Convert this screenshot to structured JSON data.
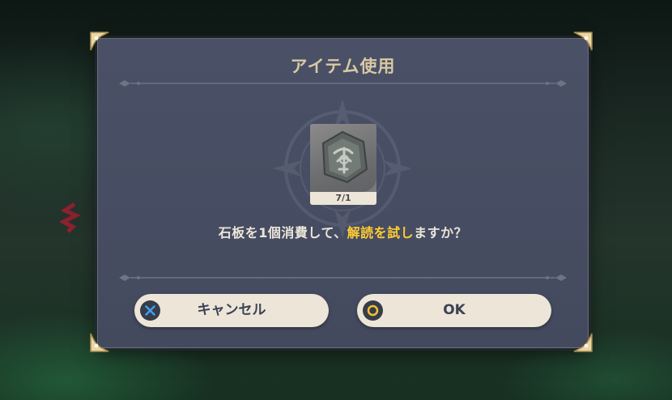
{
  "dialog": {
    "title": "アイテム使用",
    "item": {
      "name": "石板",
      "icon": "stone-tablet-icon",
      "count_label": "7/1"
    },
    "message": {
      "before": "石板を1個消費して、",
      "highlight": "解読を試し",
      "after": "ますか？"
    },
    "buttons": {
      "cancel": {
        "label": "キャンセル",
        "icon": "cross-button-icon",
        "icon_color": "#3ea0f0"
      },
      "ok": {
        "label": "OK",
        "icon": "circle-button-icon",
        "icon_color": "#f2c230"
      }
    }
  },
  "colors": {
    "panel": "#474d62",
    "title": "#d8c9a4",
    "text": "#ece5d8",
    "highlight": "#ffcc33",
    "button_bg": "#ece5d8",
    "button_text": "#3b4255"
  }
}
